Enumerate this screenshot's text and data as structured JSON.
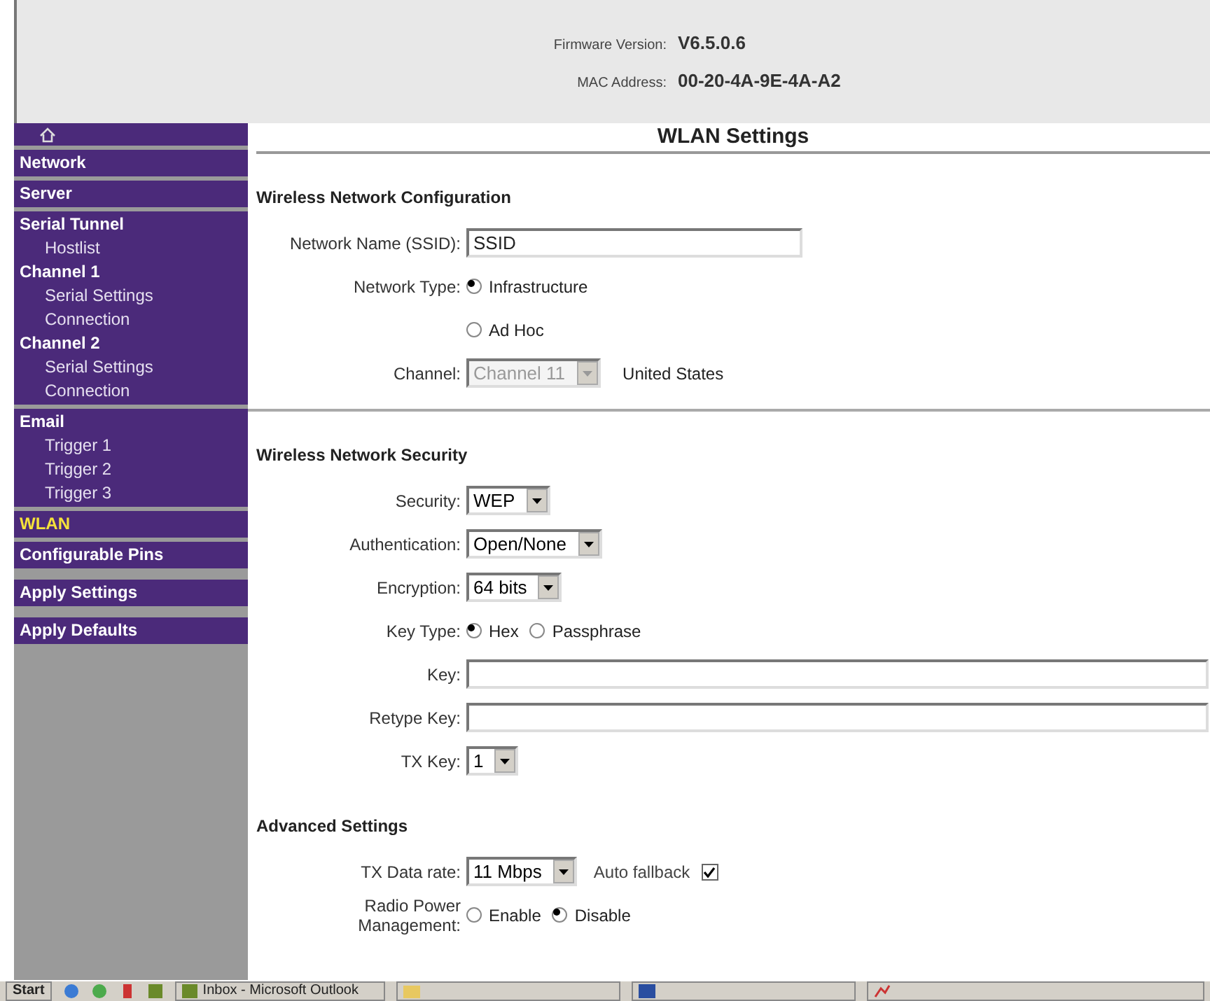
{
  "header": {
    "firmware_label": "Firmware Version:",
    "firmware": "V6.5.0.6",
    "mac_label": "MAC Address:",
    "mac": "00-20-4A-9E-4A-A2"
  },
  "sidebar": {
    "groups": [
      {
        "kind": "thin",
        "items": [
          {
            "label": "Network",
            "kind": "header",
            "selected": false
          }
        ]
      },
      {
        "kind": "thin",
        "items": [
          {
            "label": "Server",
            "kind": "header",
            "selected": false
          }
        ]
      },
      {
        "kind": "thin",
        "items": [
          {
            "label": "Serial Tunnel",
            "kind": "header",
            "selected": false
          },
          {
            "label": "Hostlist",
            "kind": "sub",
            "selected": false
          },
          {
            "label": "Channel 1",
            "kind": "header",
            "selected": false
          },
          {
            "label": "Serial Settings",
            "kind": "sub",
            "selected": false
          },
          {
            "label": "Connection",
            "kind": "sub",
            "selected": false
          },
          {
            "label": "Channel 2",
            "kind": "header",
            "selected": false
          },
          {
            "label": "Serial Settings",
            "kind": "sub",
            "selected": false
          },
          {
            "label": "Connection",
            "kind": "sub",
            "selected": false
          }
        ]
      },
      {
        "kind": "thin",
        "items": [
          {
            "label": "Email",
            "kind": "header",
            "selected": false
          },
          {
            "label": "Trigger 1",
            "kind": "sub",
            "selected": false
          },
          {
            "label": "Trigger 2",
            "kind": "sub",
            "selected": false
          },
          {
            "label": "Trigger 3",
            "kind": "sub",
            "selected": false
          }
        ]
      },
      {
        "kind": "thin",
        "items": [
          {
            "label": "WLAN",
            "kind": "header",
            "selected": true
          }
        ]
      },
      {
        "kind": "thin",
        "items": [
          {
            "label": "Configurable Pins",
            "kind": "header",
            "selected": false
          }
        ]
      },
      {
        "kind": "wide",
        "items": [
          {
            "label": "Apply Settings",
            "kind": "header",
            "selected": false
          }
        ]
      },
      {
        "kind": "wide",
        "items": [
          {
            "label": "Apply Defaults",
            "kind": "header",
            "selected": false
          }
        ]
      }
    ]
  },
  "page_title": "WLAN Settings",
  "sections": [
    {
      "title": "Wireless Network Configuration",
      "divider": true,
      "rows": [
        {
          "kind": "text",
          "label": "Network Name (SSID):",
          "value": "SSID"
        },
        {
          "kind": "radio",
          "label": "Network Type:",
          "options": [
            {
              "label": "Infrastructure",
              "selected": true
            }
          ]
        },
        {
          "kind": "radio",
          "options": [
            {
              "label": "Ad Hoc",
              "selected": false
            }
          ]
        },
        {
          "kind": "select",
          "label": "Channel:",
          "value": "Channel 11",
          "disabled": true,
          "note": "United States"
        }
      ]
    },
    {
      "title": "Wireless Network Security",
      "divider": false,
      "rows": [
        {
          "kind": "select",
          "label": "Security:",
          "value": "WEP",
          "disabled": false
        },
        {
          "kind": "select",
          "label": "Authentication:",
          "value": "Open/None",
          "disabled": false
        },
        {
          "kind": "select",
          "label": "Encryption:",
          "value": "64 bits",
          "disabled": false
        },
        {
          "kind": "radio",
          "label": "Key Type:",
          "options": [
            {
              "label": "Hex",
              "selected": true
            },
            {
              "label": "Passphrase",
              "selected": false
            }
          ]
        },
        {
          "kind": "wide-text",
          "label": "Key:"
        },
        {
          "kind": "wide-text",
          "label": "Retype Key:"
        },
        {
          "kind": "select",
          "label": "TX Key:",
          "value": "1",
          "disabled": false
        }
      ]
    },
    {
      "title": "Advanced Settings",
      "divider": false,
      "rows": [
        {
          "kind": "select",
          "label": "TX Data rate:",
          "value": "11 Mbps",
          "disabled": false,
          "checkbox": {
            "label": "Auto fallback",
            "checked": true
          }
        },
        {
          "kind": "radio",
          "label": "Radio Power Management:",
          "options": [
            {
              "label": "Enable",
              "selected": false
            },
            {
              "label": "Disable",
              "selected": true
            }
          ]
        }
      ]
    }
  ],
  "taskbar": {
    "start": "Start",
    "tasks": [
      {
        "label": "Inbox - Microsoft Outlook"
      }
    ]
  }
}
